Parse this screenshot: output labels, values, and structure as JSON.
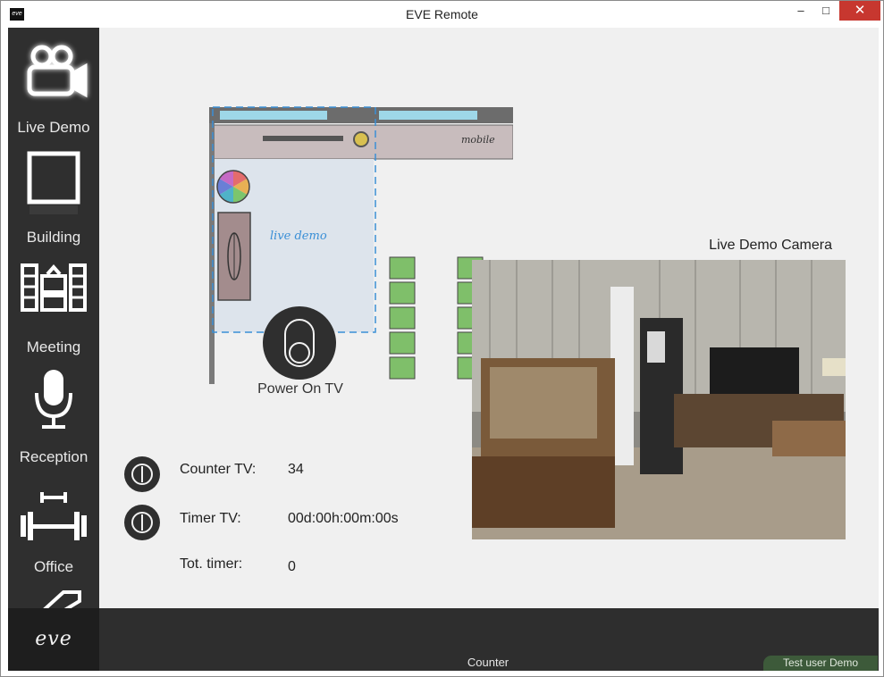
{
  "window": {
    "title": "EVE Remote",
    "minimize": "–",
    "maximize": "□",
    "close": "✕"
  },
  "app_icon_text": "eve",
  "sidebar": {
    "items": [
      {
        "label": "Live Demo",
        "icon": "video-camera-icon",
        "active": true
      },
      {
        "label": "Building",
        "icon": "building-square-icon"
      },
      {
        "label": "Meeting",
        "icon": "meeting-tv-icon"
      },
      {
        "label": "Reception",
        "icon": "microphone-icon"
      },
      {
        "label": "Office",
        "icon": "dumbbell-icon"
      }
    ],
    "logo": "eve"
  },
  "floorplan": {
    "room_label": "live demo",
    "area_label": "mobile"
  },
  "power": {
    "label": "Power On TV"
  },
  "camera": {
    "title": "Live Demo Camera"
  },
  "stats": {
    "counter_label": "Counter TV:",
    "counter_value": "34",
    "timer_label": "Timer TV:",
    "timer_value": "00d:00h:00m:00s",
    "total_label": "Tot. timer:",
    "total_value": "0"
  },
  "bottom": {
    "label": "Counter",
    "user": "Test user Demo"
  },
  "colors": {
    "sidebar": "#2f2f2f",
    "content_bg": "#f0f0f0",
    "accent_blue": "#3a8fd6",
    "close_red": "#c7372f"
  }
}
